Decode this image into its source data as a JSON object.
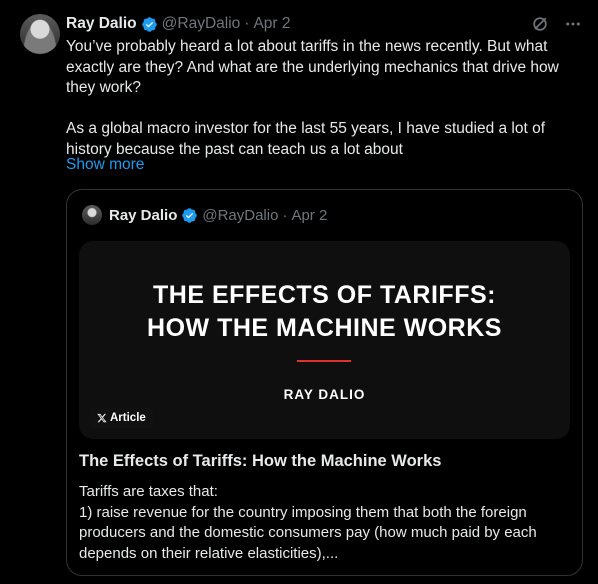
{
  "tweet": {
    "author_name": "Ray Dalio",
    "handle": "@RayDalio",
    "separator": "·",
    "date": "Apr 2",
    "paragraph1": "You’ve probably heard a lot about tariffs in the news recently. But what exactly are they? And what are the underlying mechanics that drive how they work?",
    "paragraph2": "As a global macro investor for the last 55 years, I have studied a lot of history because the past can teach us a lot about",
    "show_more": "Show more"
  },
  "quote": {
    "author_name": "Ray Dalio",
    "handle": "@RayDalio",
    "separator": "·",
    "date": "Apr 2",
    "article_cover": {
      "title_line1": "THE EFFECTS OF TARIFFS:",
      "title_line2": "HOW THE MACHINE WORKS",
      "author": "RAY DALIO",
      "badge": "Article"
    },
    "title": "The Effects of Tariffs: How the Machine Works",
    "body_line1": "Tariffs are taxes that:",
    "body_line2": "1) raise revenue for the country imposing them that both the foreign producers and the domestic consumers pay (how much paid by each depends on their relative elasticities),..."
  },
  "colors": {
    "accent": "#1d9bf0",
    "verified": "#1d9bf0",
    "muted": "#71767b",
    "cover_rule": "#e0302a"
  },
  "icons": [
    "verified-badge-icon",
    "grok-icon",
    "more-options-icon",
    "x-logo-icon"
  ]
}
